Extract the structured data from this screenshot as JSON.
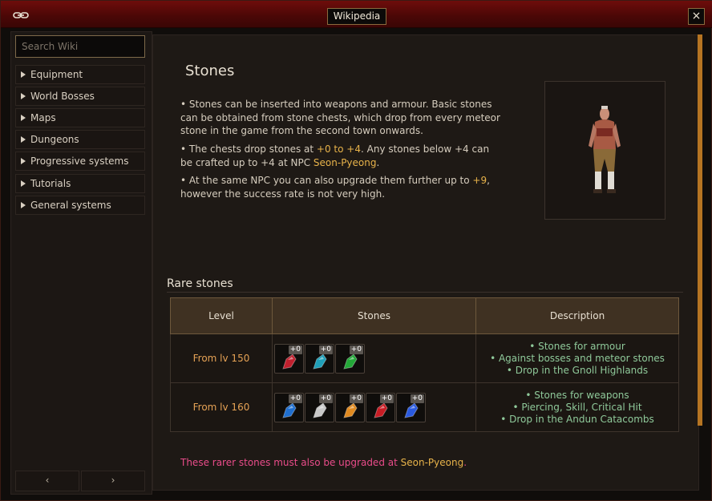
{
  "window": {
    "title": "Wikipedia",
    "close_label": "×"
  },
  "sidebar": {
    "search_placeholder": "Search Wiki",
    "items": [
      {
        "label": "Equipment"
      },
      {
        "label": "World Bosses"
      },
      {
        "label": "Maps"
      },
      {
        "label": "Dungeons"
      },
      {
        "label": "Progressive systems"
      },
      {
        "label": "Tutorials"
      },
      {
        "label": "General systems"
      }
    ],
    "prev_label": "‹",
    "next_label": "›"
  },
  "article": {
    "title": "Stones",
    "p1": "• Stones can be inserted into weapons and armour. Basic stones can be obtained from stone chests, which drop from every meteor stone in the game from the second town onwards.",
    "p2_a": "• The chests drop stones at ",
    "p2_hl": "+0 to +4",
    "p2_b": ". Any stones below +4 can be crafted up to +4 at NPC ",
    "p2_npc": "Seon-Pyeong",
    "p2_c": ".",
    "p3_a": "• At the same NPC you can also upgrade them further up to ",
    "p3_hl": "+9",
    "p3_b": ", however the success rate is not very high."
  },
  "rare": {
    "title": "Rare stones",
    "headers": {
      "level": "Level",
      "stones": "Stones",
      "description": "Description"
    },
    "rows": [
      {
        "level": "From lv 150",
        "stones": [
          {
            "badge": "+0",
            "color": "#c0202e"
          },
          {
            "badge": "+0",
            "color": "#1f9fb8"
          },
          {
            "badge": "+0",
            "color": "#23a838"
          }
        ],
        "desc": [
          "• Stones for armour",
          "• Against bosses and meteor stones",
          "• Drop in the Gnoll Highlands"
        ]
      },
      {
        "level": "From lv 160",
        "stones": [
          {
            "badge": "+0",
            "color": "#1f6fd0"
          },
          {
            "badge": "+0",
            "color": "#c8c8c8"
          },
          {
            "badge": "+0",
            "color": "#e08a20"
          },
          {
            "badge": "+0",
            "color": "#c81c24"
          },
          {
            "badge": "+0",
            "color": "#2a5ae0"
          }
        ],
        "desc": [
          "• Stones for weapons",
          "• Piercing, Skill, Critical Hit",
          "• Drop in the Andun Catacombs"
        ]
      }
    ],
    "footnote_a": "These rarer stones must also be upgraded at ",
    "footnote_npc": "Seon-Pyeong",
    "footnote_b": "."
  }
}
